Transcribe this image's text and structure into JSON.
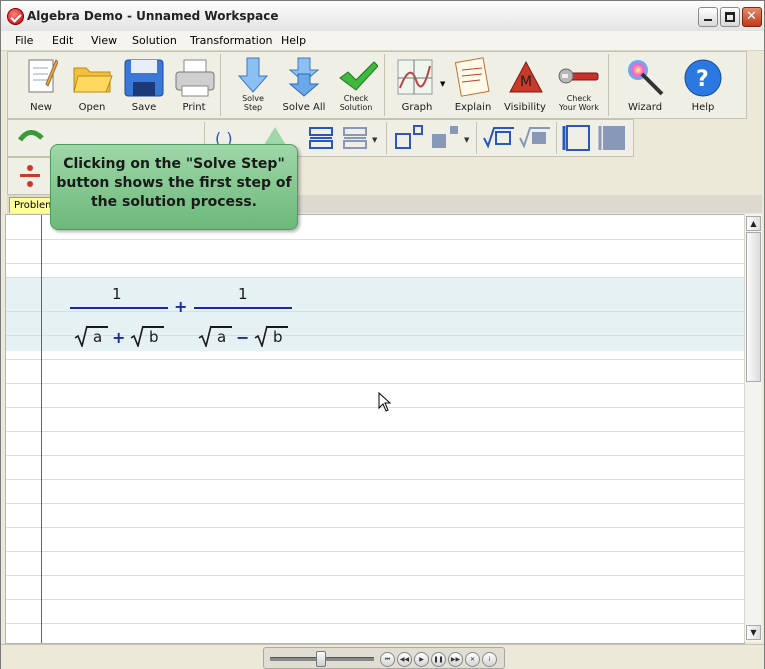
{
  "window": {
    "title": "Algebra Demo - Unnamed Workspace"
  },
  "menu": [
    "File",
    "Edit",
    "View",
    "Solution",
    "Transformation",
    "Help"
  ],
  "toolbar": {
    "new": "New",
    "open": "Open",
    "save": "Save",
    "print": "Print",
    "solve_step": "Solve\nStep",
    "solve_all": "Solve All",
    "check_solution": "Check\nSolution",
    "graph": "Graph",
    "explain": "Explain",
    "visibility": "Visibility",
    "check_your_work": "Check\nYour Work",
    "wizard": "Wizard",
    "help": "Help",
    "visibility_icon_letter": "M"
  },
  "tab": {
    "label": "Problem"
  },
  "callout": {
    "text": "Clicking on the \"Solve Step\"\nbutton shows the first step of\nthe solution process."
  },
  "expression": {
    "num1": "1",
    "a1": "a",
    "op1": "+",
    "b1": "b",
    "plus": "+",
    "num2": "1",
    "a2": "a",
    "op2": "−",
    "b2": "b"
  },
  "colors": {
    "accent": "#1a2a9a",
    "margin": "#cc3b3b",
    "callout": "#7cc48a"
  },
  "icons": [
    "new-document-icon",
    "open-folder-icon",
    "save-disk-icon",
    "printer-icon",
    "solve-step-arrow-icon",
    "solve-all-arrows-icon",
    "checkmark-icon",
    "graph-icon",
    "explain-icon",
    "visibility-icon",
    "wrench-icon",
    "magic-wand-icon",
    "help-question-icon"
  ]
}
